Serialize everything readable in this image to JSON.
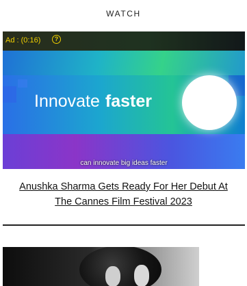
{
  "section": {
    "title": "WATCH"
  },
  "video": {
    "ad_label": "Ad : (0:16)",
    "help_icon": "question-circle-icon",
    "headline_light": "Innovate",
    "headline_bold": "faster",
    "caption": "can innovate big ideas faster",
    "colors": {
      "ad_text": "#f0d000",
      "circle": "#ffffff"
    }
  },
  "article": {
    "title": "Anushka Sharma Gets Ready For Her Debut At The Cannes Film Festival 2023"
  },
  "next_item": {
    "image_alt": "black and white photo of two women with curly hair"
  }
}
